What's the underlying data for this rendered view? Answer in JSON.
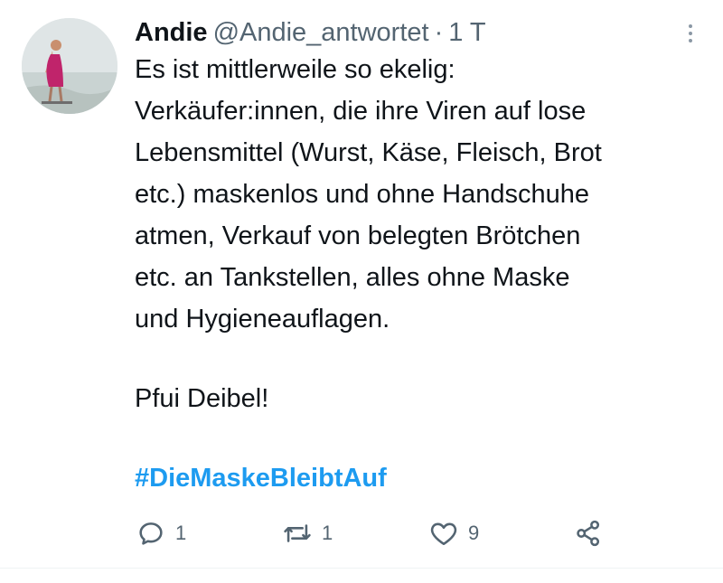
{
  "author": {
    "name": "Andie",
    "handle": "@Andie_antwortet",
    "separator": "·",
    "time": "1 T"
  },
  "tweet": {
    "lines": [
      "Es ist mittlerweile so ekelig:",
      "Verkäufer:innen, die ihre Viren auf lose",
      "Lebensmittel (Wurst, Käse, Fleisch, Brot",
      "etc.) maskenlos und ohne Handschuhe",
      "atmen, Verkauf von belegten Brötchen",
      "etc. an Tankstellen, alles ohne Maske",
      "und Hygieneauflagen."
    ],
    "closing": "Pfui Deibel!",
    "hashtag": "#DieMaskeBleibtAuf"
  },
  "actions": {
    "reply_count": "1",
    "retweet_count": "1",
    "like_count": "9"
  },
  "icons": {
    "avatar": "profile-photo",
    "more": "more-dots-icon",
    "reply": "reply-icon",
    "retweet": "retweet-icon",
    "like": "heart-icon",
    "share": "share-icon"
  },
  "colors": {
    "hashtag": "#1d9bf0",
    "secondary_text": "#536471",
    "primary_text": "#0f1419"
  }
}
